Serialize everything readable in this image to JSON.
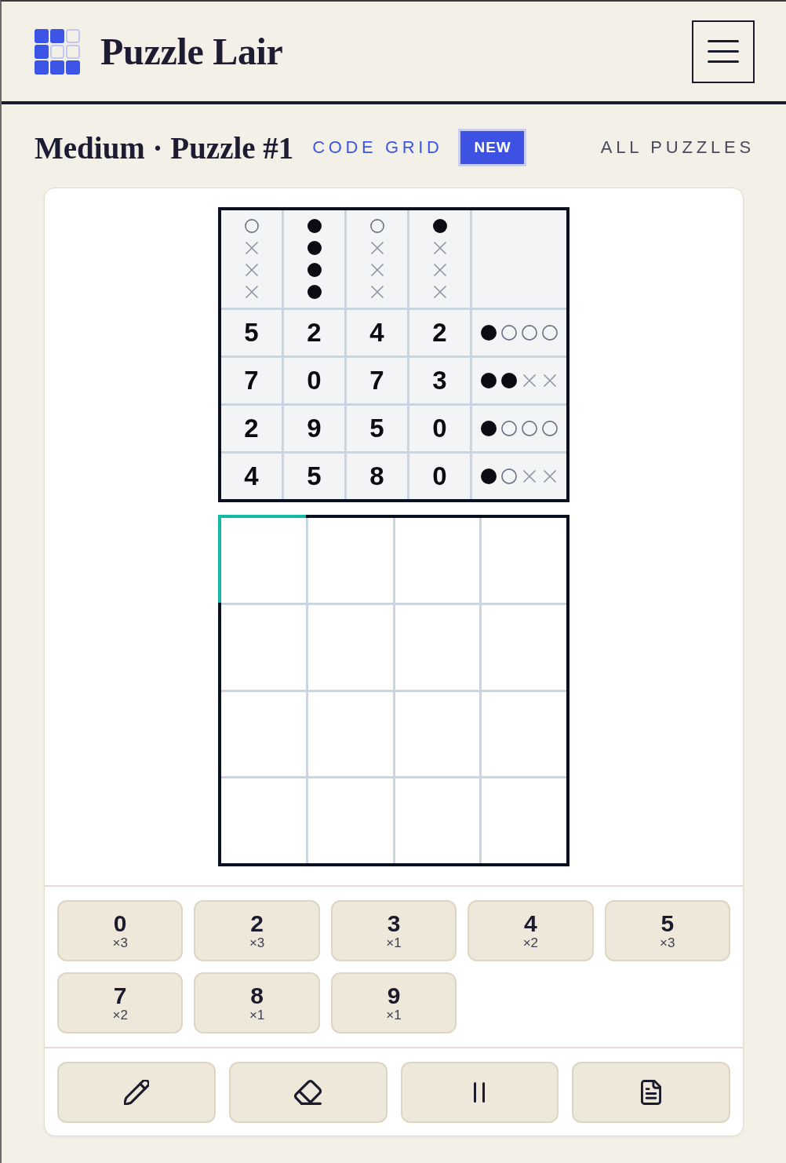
{
  "header": {
    "title": "Puzzle Lair"
  },
  "subheader": {
    "title": "Medium · Puzzle #1",
    "category": "CODE GRID",
    "badge": "NEW",
    "link": "ALL PUZZLES"
  },
  "clue_board": {
    "mark_columns": [
      {
        "marks": [
          {
            "kind": "hollow"
          },
          {
            "kind": "cross"
          },
          {
            "kind": "cross"
          },
          {
            "kind": "cross"
          }
        ]
      },
      {
        "marks": [
          {
            "kind": "filled"
          },
          {
            "kind": "filled"
          },
          {
            "kind": "filled"
          },
          {
            "kind": "filled"
          }
        ]
      },
      {
        "marks": [
          {
            "kind": "hollow"
          },
          {
            "kind": "cross"
          },
          {
            "kind": "cross"
          },
          {
            "kind": "cross"
          }
        ]
      },
      {
        "marks": [
          {
            "kind": "filled"
          },
          {
            "kind": "cross"
          },
          {
            "kind": "cross"
          },
          {
            "kind": "cross"
          }
        ]
      }
    ],
    "rows": [
      {
        "digits": [
          "5",
          "2",
          "4",
          "2"
        ],
        "feedback": [
          {
            "kind": "filled"
          },
          {
            "kind": "hollow"
          },
          {
            "kind": "hollow"
          },
          {
            "kind": "hollow"
          }
        ]
      },
      {
        "digits": [
          "7",
          "0",
          "7",
          "3"
        ],
        "feedback": [
          {
            "kind": "filled"
          },
          {
            "kind": "filled"
          },
          {
            "kind": "cross"
          },
          {
            "kind": "cross"
          }
        ]
      },
      {
        "digits": [
          "2",
          "9",
          "5",
          "0"
        ],
        "feedback": [
          {
            "kind": "filled"
          },
          {
            "kind": "hollow"
          },
          {
            "kind": "hollow"
          },
          {
            "kind": "hollow"
          }
        ]
      },
      {
        "digits": [
          "4",
          "5",
          "8",
          "0"
        ],
        "feedback": [
          {
            "kind": "filled"
          },
          {
            "kind": "hollow"
          },
          {
            "kind": "cross"
          },
          {
            "kind": "cross"
          }
        ]
      }
    ]
  },
  "answer_board": {
    "rows": [
      {
        "cells": [
          {
            "selected": true
          },
          {
            "selected": false
          },
          {
            "selected": false
          },
          {
            "selected": false
          }
        ]
      },
      {
        "cells": [
          {
            "selected": false
          },
          {
            "selected": false
          },
          {
            "selected": false
          },
          {
            "selected": false
          }
        ]
      },
      {
        "cells": [
          {
            "selected": false
          },
          {
            "selected": false
          },
          {
            "selected": false
          },
          {
            "selected": false
          }
        ]
      },
      {
        "cells": [
          {
            "selected": false
          },
          {
            "selected": false
          },
          {
            "selected": false
          },
          {
            "selected": false
          }
        ]
      }
    ]
  },
  "number_pad": [
    {
      "digit": "0",
      "count": "×3"
    },
    {
      "digit": "2",
      "count": "×3"
    },
    {
      "digit": "3",
      "count": "×1"
    },
    {
      "digit": "4",
      "count": "×2"
    },
    {
      "digit": "5",
      "count": "×3"
    },
    {
      "digit": "7",
      "count": "×2"
    },
    {
      "digit": "8",
      "count": "×1"
    },
    {
      "digit": "9",
      "count": "×1"
    }
  ],
  "tools": [
    {
      "kind": "pencil"
    },
    {
      "kind": "eraser"
    },
    {
      "kind": "pause"
    },
    {
      "kind": "notes"
    }
  ]
}
